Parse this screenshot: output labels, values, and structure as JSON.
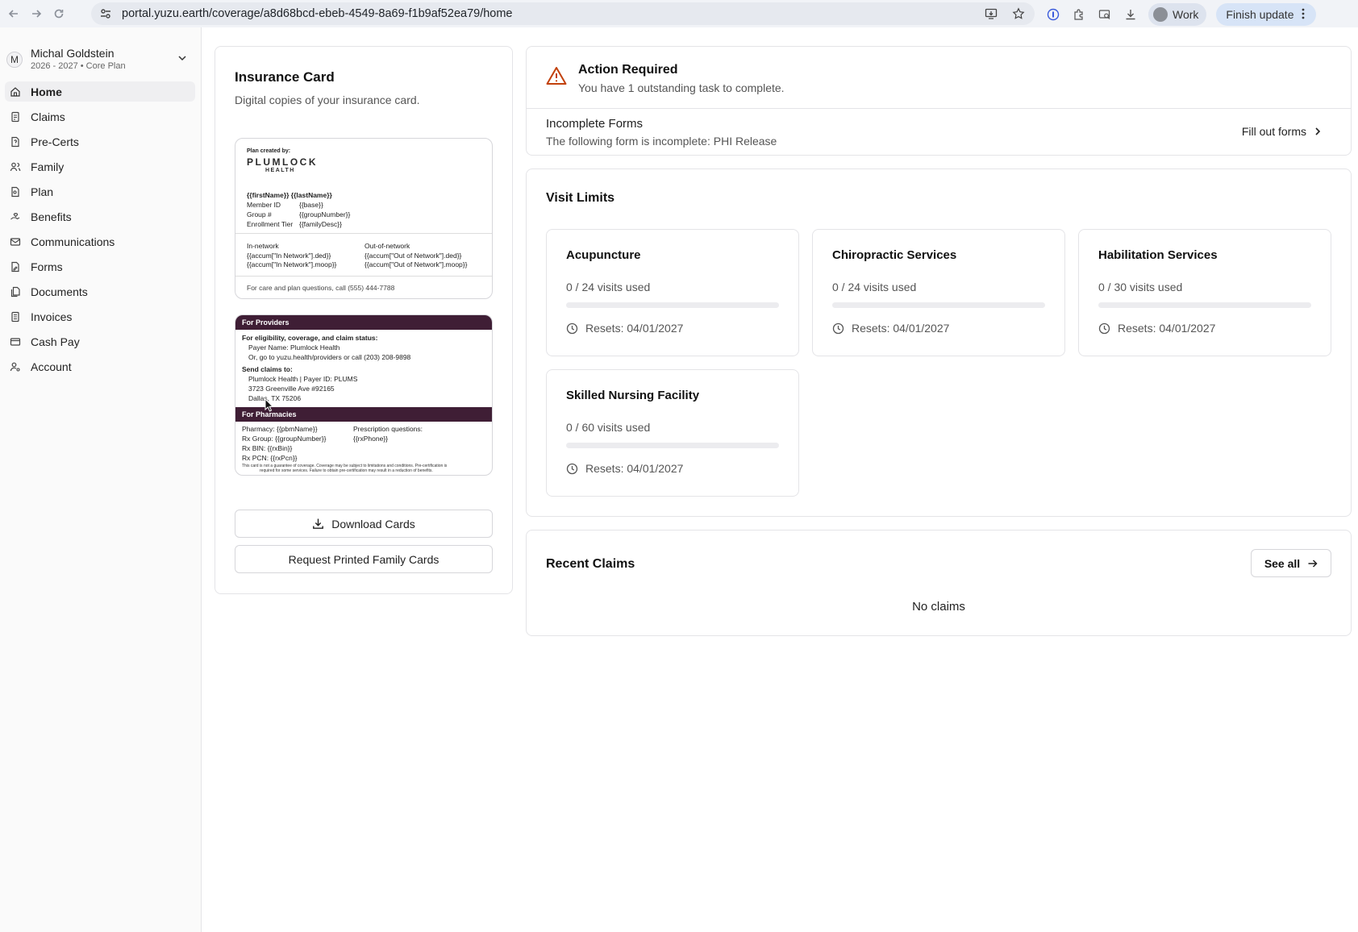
{
  "browser": {
    "url": "portal.yuzu.earth/coverage/a8d68bcd-ebeb-4549-8a69-f1b9af52ea79/home",
    "profile_label": "Work",
    "finish_update_label": "Finish update"
  },
  "sidebar": {
    "user_initial": "M",
    "user_name": "Michal Goldstein",
    "user_plan": "2026 - 2027 • Core Plan",
    "items": [
      {
        "label": "Home"
      },
      {
        "label": "Claims"
      },
      {
        "label": "Pre-Certs"
      },
      {
        "label": "Family"
      },
      {
        "label": "Plan"
      },
      {
        "label": "Benefits"
      },
      {
        "label": "Communications"
      },
      {
        "label": "Forms"
      },
      {
        "label": "Documents"
      },
      {
        "label": "Invoices"
      },
      {
        "label": "Cash Pay"
      },
      {
        "label": "Account"
      }
    ]
  },
  "insurance_card": {
    "title": "Insurance Card",
    "subtitle": "Digital copies of your insurance card.",
    "front": {
      "created_by": "Plan created by:",
      "logo_main": "PLUMLOCK",
      "logo_sub": "HEALTH",
      "name_line": "{{firstName}} {{lastName}}",
      "member_id_label": "Member ID",
      "member_id_value": "{{base}}",
      "group_label": "Group #",
      "group_value": "{{groupNumber}}",
      "tier_label": "Enrollment Tier",
      "tier_value": "{{familyDesc}}",
      "in_network_label": "In-network",
      "in_network_ded": "{{accum[\"In Network\"].ded}}",
      "in_network_moop": "{{accum[\"In Network\"].moop}}",
      "out_network_label": "Out-of-network",
      "out_network_ded": "{{accum[\"Out of Network\"].ded}}",
      "out_network_moop": "{{accum[\"Out of Network\"].moop}}",
      "footer": "For care and plan questions, call (555) 444-7788"
    },
    "back": {
      "providers_header": "For Providers",
      "eligibility_title": "For eligibility, coverage, and claim status:",
      "payer_name": "Payer Name: Plumlock Health",
      "goto_line": "Or, go to yuzu.health/providers or call (203) 208-9898",
      "send_claims_title": "Send claims to:",
      "claims_line1": "Plumlock Health | Payer ID: PLUMS",
      "claims_line2": "3723 Greenville Ave #92165",
      "claims_line3": "Dallas, TX 75206",
      "pharmacies_header": "For Pharmacies",
      "pharmacy": "Pharmacy: {{pbmName}}",
      "rx_group": "Rx Group: {{groupNumber}}",
      "rx_bin": "Rx BIN: {{rxBin}}",
      "rx_pcn": "Rx PCN: {{rxPcn}}",
      "rx_questions": "Prescription questions:",
      "rx_phone": "{{rxPhone}}",
      "disclaimer_1": "This card is not a guarantee of coverage. Coverage may be subject to limitations and conditions. Pre-certification is",
      "disclaimer_2": "required for some services. Failure to obtain pre-certification may result in a reduction of benefits."
    },
    "download_label": "Download Cards",
    "request_label": "Request Printed Family Cards"
  },
  "action_required": {
    "title": "Action Required",
    "subtitle": "You have 1 outstanding task to complete.",
    "form_title": "Incomplete Forms",
    "form_desc": "The following form is incomplete: PHI Release",
    "fill_label": "Fill out forms"
  },
  "visit_limits": {
    "title": "Visit Limits",
    "items": [
      {
        "name": "Acupuncture",
        "used_text": "0 / 24 visits used",
        "used": 0,
        "total": 24,
        "resets": "Resets: 04/01/2027"
      },
      {
        "name": "Chiropractic Services",
        "used_text": "0 / 24 visits used",
        "used": 0,
        "total": 24,
        "resets": "Resets: 04/01/2027"
      },
      {
        "name": "Habilitation Services",
        "used_text": "0 / 30 visits used",
        "used": 0,
        "total": 30,
        "resets": "Resets: 04/01/2027"
      },
      {
        "name": "Skilled Nursing Facility",
        "used_text": "0 / 60 visits used",
        "used": 0,
        "total": 60,
        "resets": "Resets: 04/01/2027"
      }
    ]
  },
  "recent_claims": {
    "title": "Recent Claims",
    "see_all_label": "See all",
    "empty_text": "No claims"
  },
  "colors": {
    "card_band": "#3f1e35",
    "warning": "#c2410c",
    "progress_fill": "#3b82f6"
  }
}
